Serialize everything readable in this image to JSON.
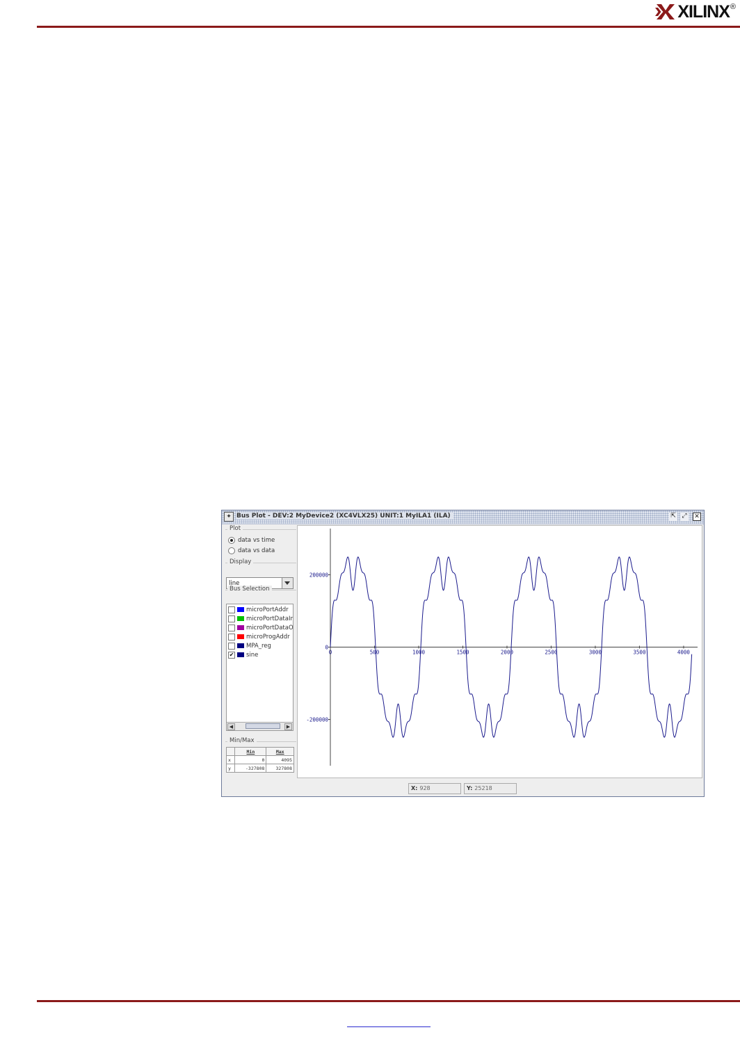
{
  "page": {
    "logo_text": "XILINX",
    "logo_reg": "®"
  },
  "window": {
    "title": "Bus Plot - DEV:2 MyDevice2 (XC4VLX25) UNIT:1 MyILA1 (ILA)",
    "icons": {
      "app": "bus-plot-app-icon",
      "restore": "restore-icon",
      "maximize": "maximize-icon",
      "close": "close-icon"
    }
  },
  "plot_panel": {
    "label": "Plot",
    "options": [
      "data vs time",
      "data vs data"
    ],
    "selected": "data vs time"
  },
  "display_panel": {
    "label": "Display",
    "value": "line"
  },
  "bus_selection": {
    "label": "Bus Selection",
    "items": [
      {
        "name": "microPortAddr",
        "color": "#0000ff",
        "checked": false
      },
      {
        "name": "microPortDataIn",
        "color": "#00c000",
        "checked": false
      },
      {
        "name": "microPortDataOut",
        "color": "#a000a0",
        "checked": false
      },
      {
        "name": "microProgAddr",
        "color": "#ff0000",
        "checked": false
      },
      {
        "name": "MPA_reg",
        "color": "#000080",
        "checked": false
      },
      {
        "name": "sine",
        "color": "#000080",
        "checked": true
      }
    ]
  },
  "minmax": {
    "label": "Min/Max",
    "headers": [
      "",
      "Min",
      "Max"
    ],
    "rows": [
      {
        "axis": "x",
        "min": "0",
        "max": "4095"
      },
      {
        "axis": "y",
        "min": "-327808",
        "max": "327808"
      }
    ]
  },
  "status": {
    "x_label": "X:",
    "x_value": "928",
    "y_label": "Y:",
    "y_value": "25218"
  },
  "chart_data": {
    "type": "line",
    "title": "",
    "xlabel": "",
    "ylabel": "",
    "xlim": [
      0,
      4095
    ],
    "ylim": [
      -327808,
      327808
    ],
    "x_ticks": [
      "0",
      "500",
      "1000",
      "1500",
      "2000",
      "2500",
      "3000",
      "3500",
      "4000"
    ],
    "y_ticks": [
      "200000",
      "0",
      "-200000"
    ],
    "series": [
      {
        "name": "sine",
        "color": "#1a1a8c",
        "period": 1024,
        "components": [
          {
            "amplitude": 250000,
            "harmonic": 1,
            "phase": 0
          },
          {
            "amplitude": 45000,
            "harmonic": 3,
            "phase": 0
          },
          {
            "amplitude": 28000,
            "harmonic": 7,
            "phase": 0
          },
          {
            "amplitude": 20000,
            "harmonic": 11,
            "phase": 0
          }
        ],
        "points": 4096
      }
    ]
  }
}
